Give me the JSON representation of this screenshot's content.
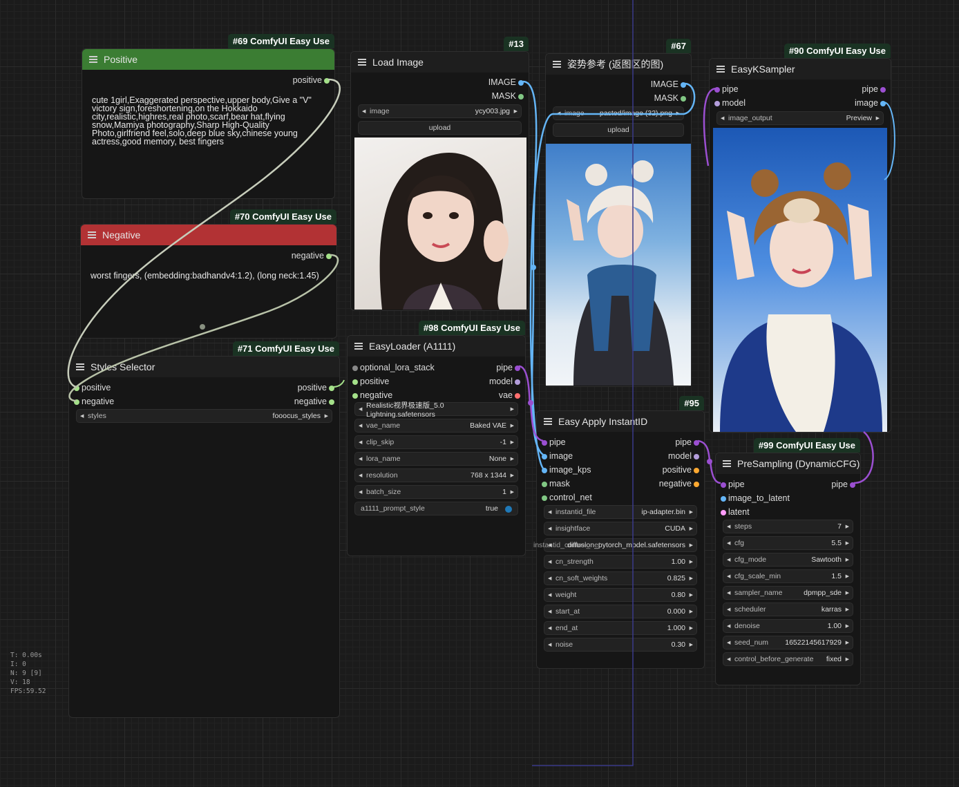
{
  "nodes": {
    "positive": {
      "badge": "#69 ComfyUI Easy Use",
      "title": "Positive",
      "out": "positive",
      "text": "cute 1girl,Exaggerated perspective,upper body,Give a \"V\" victory sign,foreshortening,on the Hokkaido city,realistic,highres,real photo,scarf,bear hat,flying snow,Mamiya photography,Sharp High-Quality Photo,girlfriend feel,solo,deep blue sky,chinese young actress,good memory, best fingers"
    },
    "negative": {
      "badge": "#70 ComfyUI Easy Use",
      "title": "Negative",
      "out": "negative",
      "text": "worst fingers, (embedding:badhandv4:1.2), (long neck:1.45)"
    },
    "styles": {
      "badge": "#71 ComfyUI Easy Use",
      "title": "Styles Selector",
      "in1": "positive",
      "in2": "negative",
      "out1": "positive",
      "out2": "negative",
      "widget": {
        "label": "styles",
        "value": "fooocus_styles"
      }
    },
    "load_image": {
      "badge": "#13",
      "title": "Load Image",
      "out1": "IMAGE",
      "out2": "MASK",
      "widget": {
        "label": "image",
        "value": "ycy003.jpg"
      },
      "upload": "upload"
    },
    "pose_ref": {
      "badge": "#67",
      "title": "姿势参考 (返图区的图)",
      "out1": "IMAGE",
      "out2": "MASK",
      "widget": {
        "label": "image",
        "value": "pasted/image (32).png"
      },
      "upload": "upload"
    },
    "ksampler": {
      "badge": "#90 ComfyUI Easy Use",
      "title": "EasyKSampler",
      "in1": "pipe",
      "in2": "model",
      "out1": "pipe",
      "out2": "image",
      "widget": {
        "label": "image_output",
        "value": "Preview"
      }
    },
    "loader": {
      "badge": "#98 ComfyUI Easy Use",
      "title": "EasyLoader (A1111)",
      "inputs": [
        "optional_lora_stack",
        "positive",
        "negative"
      ],
      "outputs": [
        "pipe",
        "model",
        "vae"
      ],
      "widgets": [
        {
          "label": "",
          "value": "Realistic视界极速版_5.0 Lightning.safetensors"
        },
        {
          "label": "vae_name",
          "value": "Baked VAE"
        },
        {
          "label": "clip_skip",
          "value": "-1"
        },
        {
          "label": "lora_name",
          "value": "None"
        },
        {
          "label": "resolution",
          "value": "768 x 1344"
        },
        {
          "label": "batch_size",
          "value": "1"
        }
      ],
      "toggle": {
        "label": "a1111_prompt_style",
        "value": "true"
      }
    },
    "instantid": {
      "badge": "#95",
      "title": "Easy Apply InstantID",
      "inputs": [
        "pipe",
        "image",
        "image_kps",
        "mask",
        "control_net"
      ],
      "outputs": [
        "pipe",
        "model",
        "positive",
        "negative"
      ],
      "widgets": [
        {
          "label": "instantid_file",
          "value": "ip-adapter.bin"
        },
        {
          "label": "insightface",
          "value": "CUDA"
        },
        {
          "label": "instantid_control_net",
          "value": "diffusion_pytorch_model.safetensors"
        },
        {
          "label": "cn_strength",
          "value": "1.00"
        },
        {
          "label": "cn_soft_weights",
          "value": "0.825"
        },
        {
          "label": "weight",
          "value": "0.80"
        },
        {
          "label": "start_at",
          "value": "0.000"
        },
        {
          "label": "end_at",
          "value": "1.000"
        },
        {
          "label": "noise",
          "value": "0.30"
        }
      ]
    },
    "presampling": {
      "badge": "#99 ComfyUI Easy Use",
      "title": "PreSampling (DynamicCFG)",
      "inputs": [
        "pipe",
        "image_to_latent",
        "latent"
      ],
      "outputs": [
        "pipe"
      ],
      "widgets": [
        {
          "label": "steps",
          "value": "7"
        },
        {
          "label": "cfg",
          "value": "5.5"
        },
        {
          "label": "cfg_mode",
          "value": "Sawtooth"
        },
        {
          "label": "cfg_scale_min",
          "value": "1.5"
        },
        {
          "label": "sampler_name",
          "value": "dpmpp_sde"
        },
        {
          "label": "scheduler",
          "value": "karras"
        },
        {
          "label": "denoise",
          "value": "1.00"
        },
        {
          "label": "seed_num",
          "value": "165221456179​29"
        },
        {
          "label": "control_before_generate",
          "value": "fixed"
        }
      ]
    }
  },
  "stats": [
    "T: 0.00s",
    "I: 0",
    "N: 9 [9]",
    "V: 18",
    "FPS:59.52"
  ],
  "colors": {
    "pipe": "#9b4fd1",
    "image": "#64b5f6",
    "mask": "#81c784",
    "model": "#b39ddb",
    "vae": "#ff6e6e",
    "cond_pos": "#a4e089",
    "latent": "#ff9cf9",
    "link_gray": "#b8c2a8"
  }
}
